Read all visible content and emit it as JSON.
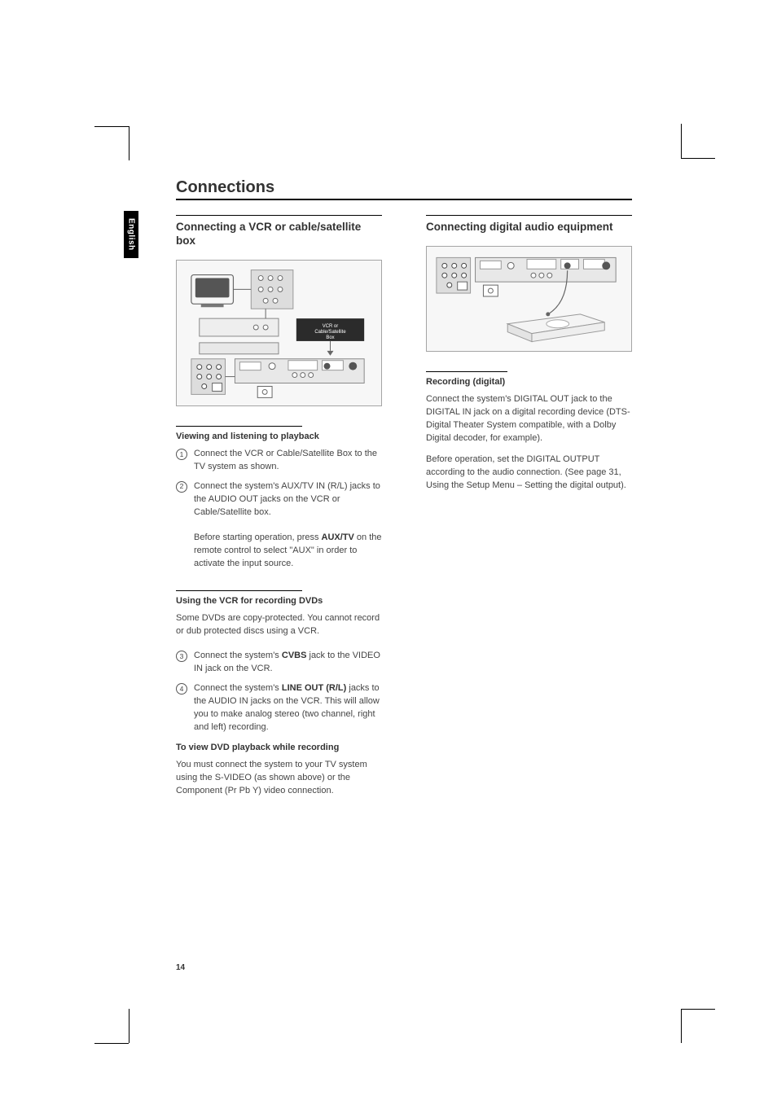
{
  "lang_tab": "English",
  "page_number": "14",
  "title": "Connections",
  "left": {
    "heading": "Connecting a VCR or cable/satellite box",
    "diagram_label": "VCR or Cable/Satellite Box",
    "sub1_heading": "Viewing and listening to playback",
    "step1_num": "1",
    "step1": "Connect the VCR or Cable/Satellite Box to the TV system as shown.",
    "step2_num": "2",
    "step2_a": "Connect the system's AUX/TV IN (R/L) jacks to the AUDIO OUT jacks on the VCR or Cable/Satellite box.",
    "step2_b_pre": "Before starting operation, press ",
    "step2_b_bold": "AUX/TV",
    "step2_b_post": " on the remote control to select \"AUX\" in order to activate the input source.",
    "sub2_heading": "Using the VCR for recording DVDs",
    "sub2_para": "Some DVDs are copy-protected. You cannot record or dub protected discs using a VCR.",
    "step3_num": "3",
    "step3_pre": "Connect the system's ",
    "step3_bold": "CVBS",
    "step3_post": " jack to the VIDEO IN jack on the VCR.",
    "step4_num": "4",
    "step4_pre": "Connect the system's ",
    "step4_bold": "LINE OUT (R/L)",
    "step4_post": " jacks to the AUDIO IN jacks on the VCR. This will allow you to make analog stereo (two channel, right and left) recording.",
    "sub3_heading": "To view DVD playback while recording",
    "sub3_para": "You must connect the system to your TV system using the S-VIDEO (as shown above) or the Component (Pr Pb Y) video connection."
  },
  "right": {
    "heading": "Connecting digital audio equipment",
    "sub1_heading": "Recording (digital)",
    "para1": "Connect the system's DIGITAL OUT jack to the DIGITAL IN jack on a digital recording device (DTS-Digital Theater System compatible, with a Dolby Digital decoder, for example).",
    "para2": "Before operation, set the DIGITAL OUTPUT according to the audio connection. (See page 31, Using the Setup Menu – Setting the digital output)."
  }
}
